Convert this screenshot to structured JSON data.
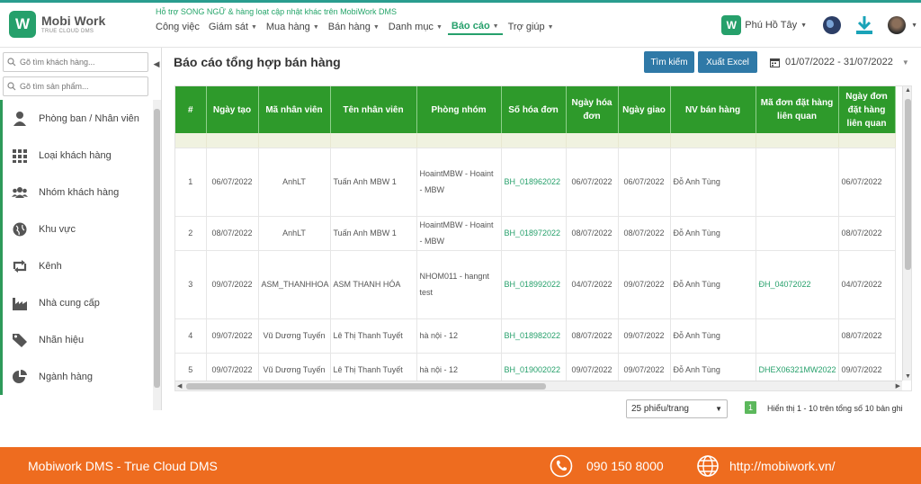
{
  "header": {
    "logo_letter": "W",
    "logo_title": "Mobi Work",
    "logo_subtitle": "TRUE CLOUD DMS",
    "notice": "Hỗ trợ SONG NGỮ & hàng loạt cập nhật khác trên MobiWork DMS",
    "nav": [
      {
        "label": "Công việc",
        "has_caret": false
      },
      {
        "label": "Giám sát",
        "has_caret": true
      },
      {
        "label": "Mua hàng",
        "has_caret": true
      },
      {
        "label": "Bán hàng",
        "has_caret": true
      },
      {
        "label": "Danh mục",
        "has_caret": true
      },
      {
        "label": "Báo cáo",
        "has_caret": true,
        "active": true
      },
      {
        "label": "Trợ giúp",
        "has_caret": true
      }
    ],
    "company_letter": "W",
    "company_name": "Phú Hồ Tây",
    "icons": [
      "globe-icon",
      "download-icon",
      "user-avatar"
    ]
  },
  "sidebar": {
    "customer_search_placeholder": "Gõ tìm khách hàng...",
    "product_search_placeholder": "Gõ tìm sản phẩm...",
    "items": [
      {
        "label": "Phòng ban / Nhân viên",
        "icon": "person-icon"
      },
      {
        "label": "Loại khách hàng",
        "icon": "grid-icon"
      },
      {
        "label": "Nhóm khách hàng",
        "icon": "group-icon"
      },
      {
        "label": "Khu vực",
        "icon": "globe-icon"
      },
      {
        "label": "Kênh",
        "icon": "retweet-icon"
      },
      {
        "label": "Nhà cung cấp",
        "icon": "factory-icon"
      },
      {
        "label": "Nhãn hiệu",
        "icon": "tag-icon"
      },
      {
        "label": "Ngành hàng",
        "icon": "pie-icon"
      }
    ]
  },
  "main": {
    "title": "Báo cáo tổng hợp bán hàng",
    "search_button": "Tìm kiếm",
    "export_button": "Xuất Excel",
    "date_range": "01/07/2022 - 31/07/2022",
    "columns": [
      "#",
      "Ngày tạo",
      "Mã nhân viên",
      "Tên nhân viên",
      "Phòng nhóm",
      "Số hóa đơn",
      "Ngày hóa đơn",
      "Ngày giao",
      "NV bán hàng",
      "Mã đơn đặt hàng liên quan",
      "Ngày đơn đặt hàng liên quan"
    ],
    "rows": [
      {
        "no": "1",
        "created": "06/07/2022",
        "emp_code": "AnhLT",
        "emp_name": "Tuấn Anh MBW 1",
        "group": "HoaintMBW - Hoaint - MBW",
        "invoice": "BH_018962022",
        "invoice_date": "06/07/2022",
        "delivery_date": "06/07/2022",
        "seller": "Đỗ Anh Tùng",
        "order_code": "",
        "order_date": "06/07/2022"
      },
      {
        "no": "2",
        "created": "08/07/2022",
        "emp_code": "AnhLT",
        "emp_name": "Tuấn Anh MBW 1",
        "group": "HoaintMBW - Hoaint - MBW",
        "invoice": "BH_018972022",
        "invoice_date": "08/07/2022",
        "delivery_date": "08/07/2022",
        "seller": "Đỗ Anh Tùng",
        "order_code": "",
        "order_date": "08/07/2022"
      },
      {
        "no": "3",
        "created": "09/07/2022",
        "emp_code": "ASM_THANHHOA",
        "emp_name": "ASM THANH HÓA",
        "group": "NHOM011 - hangnt test",
        "invoice": "BH_018992022",
        "invoice_date": "04/07/2022",
        "delivery_date": "09/07/2022",
        "seller": "Đỗ Anh Tùng",
        "order_code": "ĐH_04072022",
        "order_date": "04/07/2022"
      },
      {
        "no": "4",
        "created": "09/07/2022",
        "emp_code": "Vũ Dương Tuyến",
        "emp_name": "Lê Thị Thanh Tuyết",
        "group": "hà nội - 12",
        "invoice": "BH_018982022",
        "invoice_date": "08/07/2022",
        "delivery_date": "09/07/2022",
        "seller": "Đỗ Anh Tùng",
        "order_code": "",
        "order_date": "08/07/2022"
      },
      {
        "no": "5",
        "created": "09/07/2022",
        "emp_code": "Vũ Dương Tuyến",
        "emp_name": "Lê Thị Thanh Tuyết",
        "group": "hà nội - 12",
        "invoice": "BH_019002022",
        "invoice_date": "09/07/2022",
        "delivery_date": "09/07/2022",
        "seller": "Đỗ Anh Tùng",
        "order_code": "DHEX06321MW2022",
        "order_date": "09/07/2022"
      }
    ],
    "page_size": "25 phiếu/trang",
    "current_page": "1",
    "page_info": "Hiển thị 1 - 10 trên tổng số 10 bản ghi"
  },
  "footer": {
    "brand": "Mobiwork DMS -  True Cloud DMS",
    "phone": "090 150 8000",
    "website": "http://mobiwork.vn/"
  },
  "colors": {
    "brand_green": "#26a06b",
    "table_header": "#2e9a2b",
    "button_blue": "#2f79a7",
    "footer_orange": "#ee6c1f"
  }
}
